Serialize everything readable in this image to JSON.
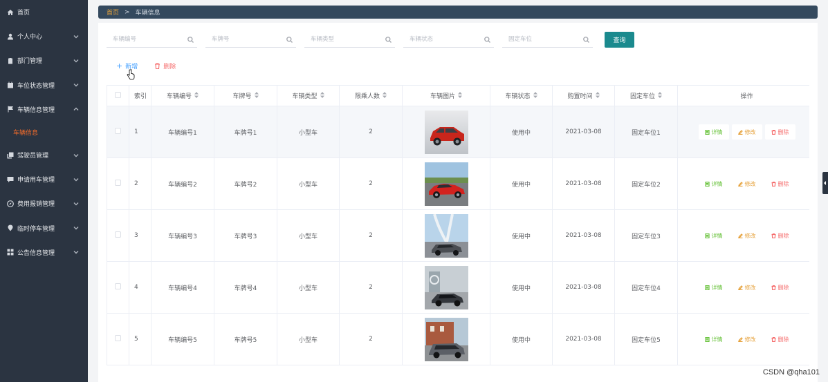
{
  "sidebar": {
    "items": [
      {
        "label": "首页",
        "icon": "home-icon",
        "has_arrow": false
      },
      {
        "label": "个人中心",
        "icon": "user-icon",
        "has_arrow": true,
        "expanded": false
      },
      {
        "label": "部门管理",
        "icon": "clipboard-icon",
        "has_arrow": true,
        "expanded": false
      },
      {
        "label": "车位状态管理",
        "icon": "calendar-icon",
        "has_arrow": true,
        "expanded": false
      },
      {
        "label": "车辆信息管理",
        "icon": "flag-icon",
        "has_arrow": true,
        "expanded": true
      },
      {
        "label": "驾驶员管理",
        "icon": "copy-icon",
        "has_arrow": true,
        "expanded": false
      },
      {
        "label": "申请用车管理",
        "icon": "message-icon",
        "has_arrow": true,
        "expanded": false
      },
      {
        "label": "费用报销管理",
        "icon": "compass-icon",
        "has_arrow": true,
        "expanded": false
      },
      {
        "label": "临时停车管理",
        "icon": "location-icon",
        "has_arrow": true,
        "expanded": false
      },
      {
        "label": "公告信息管理",
        "icon": "grid-icon",
        "has_arrow": true,
        "expanded": false
      }
    ],
    "active_sub_item": "车辆信息"
  },
  "breadcrumb": {
    "home": "首页",
    "separator": ">",
    "current": "车辆信息"
  },
  "search": {
    "fields": [
      {
        "placeholder": "车辆编号"
      },
      {
        "placeholder": "车牌号"
      },
      {
        "placeholder": "车辆类型"
      },
      {
        "placeholder": "车辆状态"
      },
      {
        "placeholder": "固定车位"
      }
    ],
    "query_label": "查询"
  },
  "actions": {
    "add_label": "新增",
    "delete_label": "删除"
  },
  "table": {
    "headers": {
      "index": "索引",
      "vehicle_no": "车辆编号",
      "plate": "车牌号",
      "type": "车辆类型",
      "capacity": "限乘人数",
      "image": "车辆图片",
      "status": "车辆状态",
      "purchase_date": "购置时间",
      "fixed_spot": "固定车位",
      "operations": "操作"
    },
    "op_labels": {
      "detail": "详情",
      "edit": "修改",
      "delete": "删除"
    },
    "rows": [
      {
        "index": "1",
        "vehicle_no": "车辆编号1",
        "plate": "车牌号1",
        "type": "小型车",
        "capacity": "2",
        "status": "使用中",
        "purchase_date": "2021-03-08",
        "fixed_spot": "固定车位1"
      },
      {
        "index": "2",
        "vehicle_no": "车辆编号2",
        "plate": "车牌号2",
        "type": "小型车",
        "capacity": "2",
        "status": "使用中",
        "purchase_date": "2021-03-08",
        "fixed_spot": "固定车位2"
      },
      {
        "index": "3",
        "vehicle_no": "车辆编号3",
        "plate": "车牌号3",
        "type": "小型车",
        "capacity": "2",
        "status": "使用中",
        "purchase_date": "2021-03-08",
        "fixed_spot": "固定车位3"
      },
      {
        "index": "4",
        "vehicle_no": "车辆编号4",
        "plate": "车牌号4",
        "type": "小型车",
        "capacity": "2",
        "status": "使用中",
        "purchase_date": "2021-03-08",
        "fixed_spot": "固定车位4"
      },
      {
        "index": "5",
        "vehicle_no": "车辆编号5",
        "plate": "车牌号5",
        "type": "小型车",
        "capacity": "2",
        "status": "使用中",
        "purchase_date": "2021-03-08",
        "fixed_spot": "固定车位5"
      }
    ]
  },
  "colors": {
    "sidebar_bg": "#2b3441",
    "active_sub": "#f56c2a",
    "query_button": "#1b8a8e",
    "detail": "#67c23a",
    "edit": "#e6a23c",
    "delete": "#f56c6c"
  },
  "watermark": "CSDN @qha101"
}
